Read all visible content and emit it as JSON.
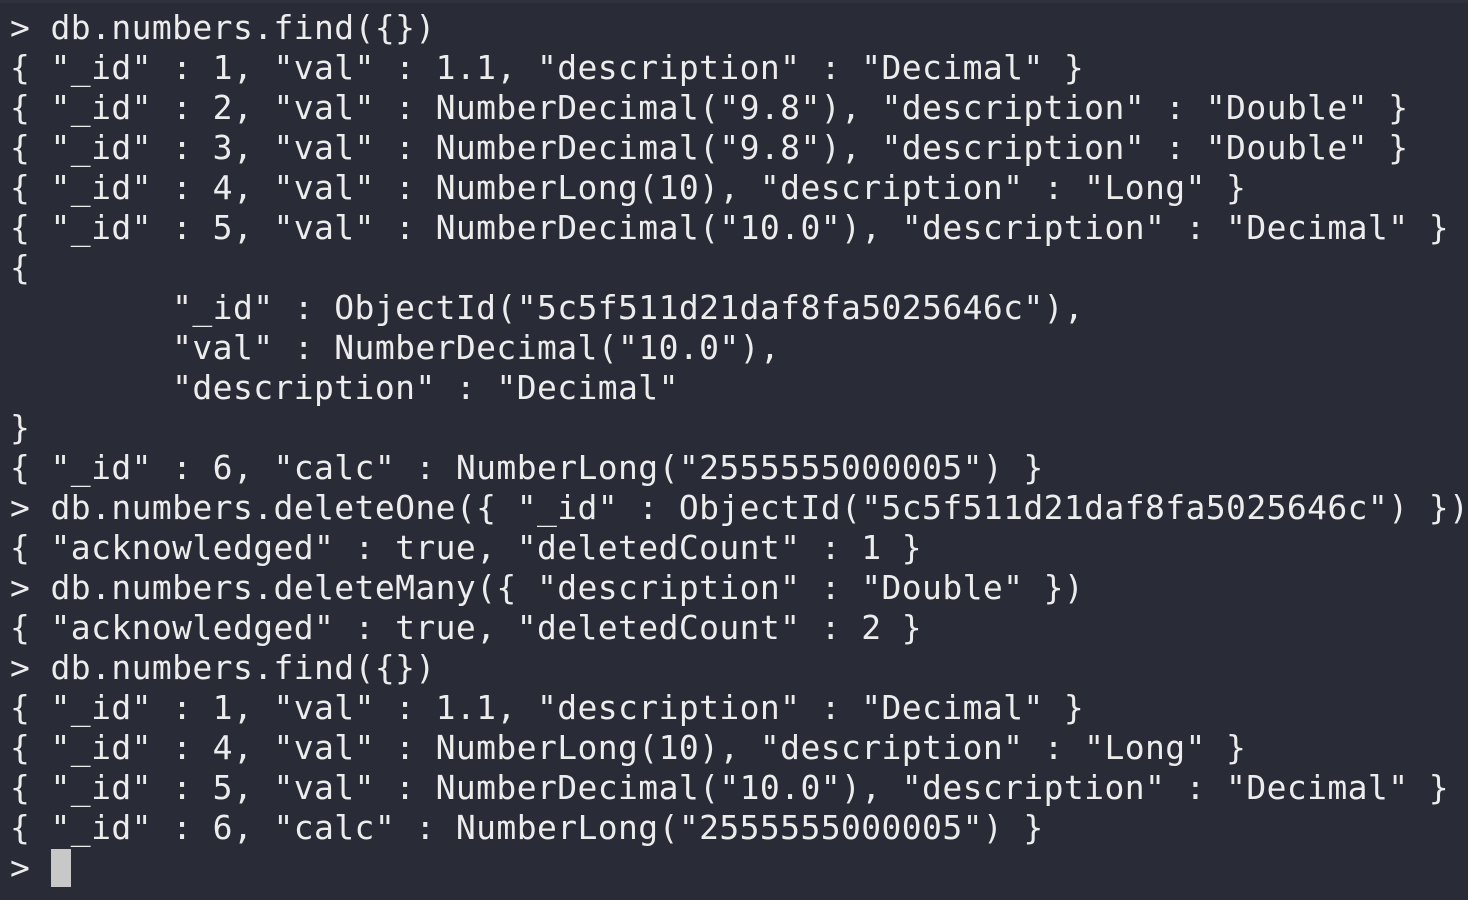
{
  "terminal": {
    "lines": [
      "> db.numbers.find({})",
      "{ \"_id\" : 1, \"val\" : 1.1, \"description\" : \"Decimal\" }",
      "{ \"_id\" : 2, \"val\" : NumberDecimal(\"9.8\"), \"description\" : \"Double\" }",
      "{ \"_id\" : 3, \"val\" : NumberDecimal(\"9.8\"), \"description\" : \"Double\" }",
      "{ \"_id\" : 4, \"val\" : NumberLong(10), \"description\" : \"Long\" }",
      "{ \"_id\" : 5, \"val\" : NumberDecimal(\"10.0\"), \"description\" : \"Decimal\" }",
      "{",
      "        \"_id\" : ObjectId(\"5c5f511d21daf8fa5025646c\"),",
      "        \"val\" : NumberDecimal(\"10.0\"),",
      "        \"description\" : \"Decimal\"",
      "}",
      "{ \"_id\" : 6, \"calc\" : NumberLong(\"2555555000005\") }",
      "> db.numbers.deleteOne({ \"_id\" : ObjectId(\"5c5f511d21daf8fa5025646c\") })",
      "{ \"acknowledged\" : true, \"deletedCount\" : 1 }",
      "> db.numbers.deleteMany({ \"description\" : \"Double\" })",
      "{ \"acknowledged\" : true, \"deletedCount\" : 2 }",
      "> db.numbers.find({})",
      "{ \"_id\" : 1, \"val\" : 1.1, \"description\" : \"Decimal\" }",
      "{ \"_id\" : 4, \"val\" : NumberLong(10), \"description\" : \"Long\" }",
      "{ \"_id\" : 5, \"val\" : NumberDecimal(\"10.0\"), \"description\" : \"Decimal\" }",
      "{ \"_id\" : 6, \"calc\" : NumberLong(\"2555555000005\") }"
    ],
    "prompt": "> ",
    "colors": {
      "background": "#292c36",
      "foreground": "#ececec",
      "cursor": "#c8c8c8"
    }
  }
}
